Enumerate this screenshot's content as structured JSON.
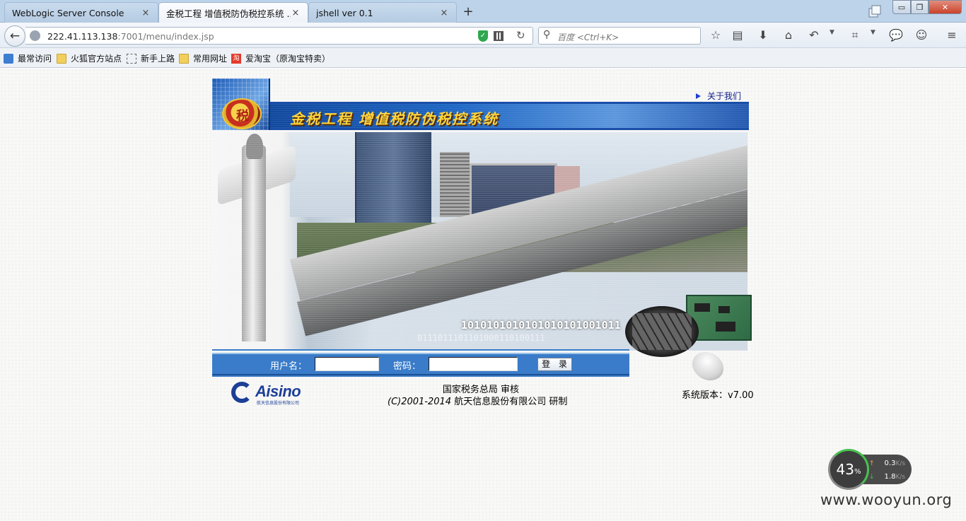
{
  "browser": {
    "tabs": [
      {
        "label": "WebLogic Server Console",
        "close": "×",
        "active": false
      },
      {
        "label": "金税工程 增值税防伪税控系统 ...",
        "close": "×",
        "active": true
      },
      {
        "label": "jshell ver 0.1",
        "close": "×",
        "active": false
      }
    ],
    "new_tab_label": "+",
    "window_controls": {
      "minimize": "▭",
      "maximize": "❐",
      "close": "✕"
    },
    "url_host": "222.41.113.138",
    "url_path": ":7001/menu/index.jsp",
    "search_placeholder": "百度 <Ctrl+K>",
    "toolbar_icons": [
      "star-icon",
      "reading-list-icon",
      "download-icon",
      "home-icon",
      "undo-icon",
      "crop-icon",
      "chat-icon",
      "emoji-icon",
      "menu-icon"
    ],
    "bookmarks": [
      {
        "label": "最常访问",
        "icon": "blue"
      },
      {
        "label": "火狐官方站点",
        "icon": "folder"
      },
      {
        "label": "新手上路",
        "icon": "dashed"
      },
      {
        "label": "常用网址",
        "icon": "folder"
      },
      {
        "label": "爱淘宝（原淘宝特卖）",
        "icon": "taobao",
        "icon_text": "淘"
      }
    ]
  },
  "page": {
    "about_link": "关于我们",
    "banner_title": "金税工程  增值税防伪税控系统",
    "emblem_text": "税",
    "binary_text": "1010101010101010101001011",
    "binary_text_2": "0111011101101000110100111",
    "login": {
      "username_label": "用户名：",
      "username_value": "",
      "password_label": "密码：",
      "password_value": "",
      "submit_label": "登 录"
    },
    "logo": {
      "name": "Aisino",
      "subtitle": "航天信息股份有限公司"
    },
    "footer_line1": "国家税务总局  审核",
    "footer_copyright": "(C)2001-2014",
    "footer_company": " 航天信息股份有限公司  研制",
    "version": "系统版本：v7.00"
  },
  "speed_widget": {
    "percent": "43",
    "percent_sign": "%",
    "upload": "0.3",
    "download": "1.8",
    "unit": "K/s",
    "up_arrow": "↑",
    "down_arrow": "↓"
  },
  "watermark": "www.wooyun.org",
  "colors": {
    "accent_blue": "#3a7cc9",
    "banner_yellow": "#ffd43a",
    "firefox_chrome": "#bcd3ea"
  }
}
